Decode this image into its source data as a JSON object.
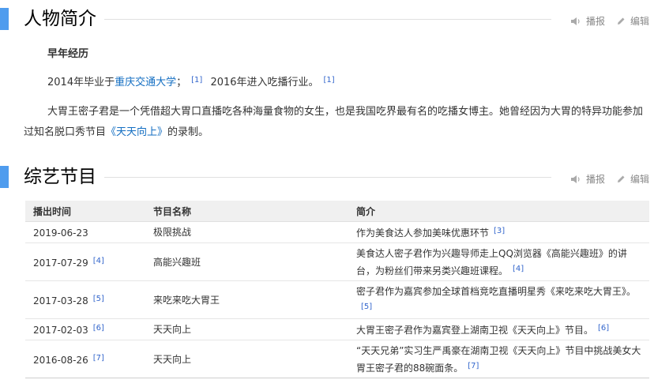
{
  "tools": {
    "play_label": "播报",
    "edit_label": "编辑"
  },
  "intro": {
    "title": "人物简介",
    "sub_title": "早年经历",
    "p1": {
      "prefix": "2014年毕业于",
      "link": "重庆交通大学",
      "suffix": "；",
      "ref1": "[1]",
      "text2": "2016年进入吃播行业。",
      "ref2": "[1]"
    },
    "p2": {
      "text": "大胃王密子君是一个凭借超大胃口直播吃各种海量食物的女生，也是我国吃界最有名的吃播女博主。她曾经因为大胃的特异功能参加过知名脱口秀节目",
      "link": "《天天向上》",
      "suffix": "的录制。"
    }
  },
  "variety": {
    "title": "综艺节目",
    "headers": [
      "播出时间",
      "节目名称",
      "简介"
    ],
    "rows": [
      {
        "date": "2019-06-23",
        "date_ref": "",
        "name": "极限挑战",
        "desc": "作为美食达人参加美味优惠环节",
        "desc_ref": "[3]"
      },
      {
        "date": "2017-07-29",
        "date_ref": "[4]",
        "name": "高能兴趣班",
        "desc": "美食达人密子君作为兴趣导师走上QQ浏览器《高能兴趣班》的讲台，为粉丝们带来另类兴趣班课程。",
        "desc_ref": "[4]"
      },
      {
        "date": "2017-03-28",
        "date_ref": "[5]",
        "name": "来吃来吃大胃王",
        "desc": "密子君作为嘉宾参加全球首档竞吃直播明星秀《来吃来吃大胃王》。",
        "desc_ref": "[5]"
      },
      {
        "date": "2017-02-03",
        "date_ref": "[6]",
        "name": "天天向上",
        "desc": "大胃王密子君作为嘉宾登上湖南卫视《天天向上》节目。",
        "desc_ref": "[6]"
      },
      {
        "date": "2016-08-26",
        "date_ref": "[7]",
        "name": "天天向上",
        "desc": "“天天兄弟”实习生严禹豪在湖南卫视《天天向上》节目中挑战美女大胃王密子君的88碗面条。",
        "desc_ref": "[7]"
      }
    ]
  }
}
